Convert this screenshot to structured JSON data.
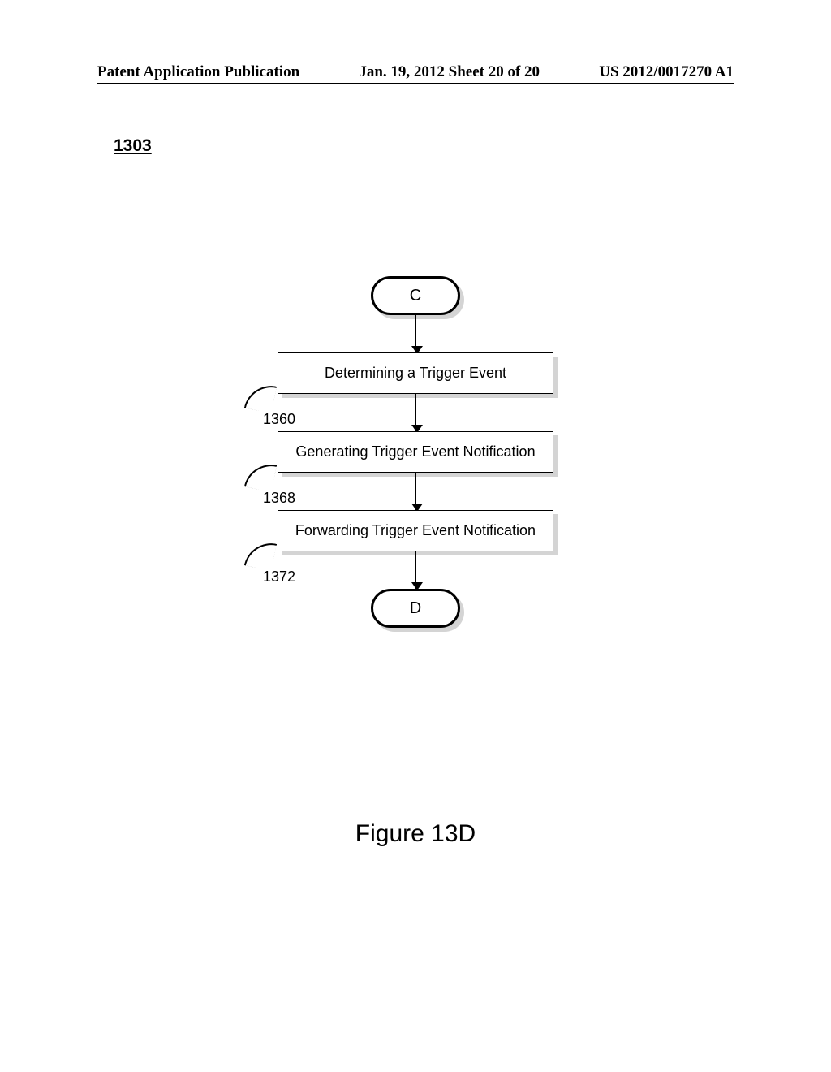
{
  "header": {
    "left": "Patent Application Publication",
    "center": "Jan. 19, 2012  Sheet 20 of 20",
    "right": "US 2012/0017270 A1"
  },
  "figure_number": "1303",
  "terminator_start": "C",
  "terminator_end": "D",
  "steps": [
    {
      "ref": "1360",
      "text": "Determining a Trigger Event"
    },
    {
      "ref": "1368",
      "text": "Generating Trigger Event Notification"
    },
    {
      "ref": "1372",
      "text": "Forwarding Trigger Event Notification"
    }
  ],
  "caption": "Figure 13D"
}
